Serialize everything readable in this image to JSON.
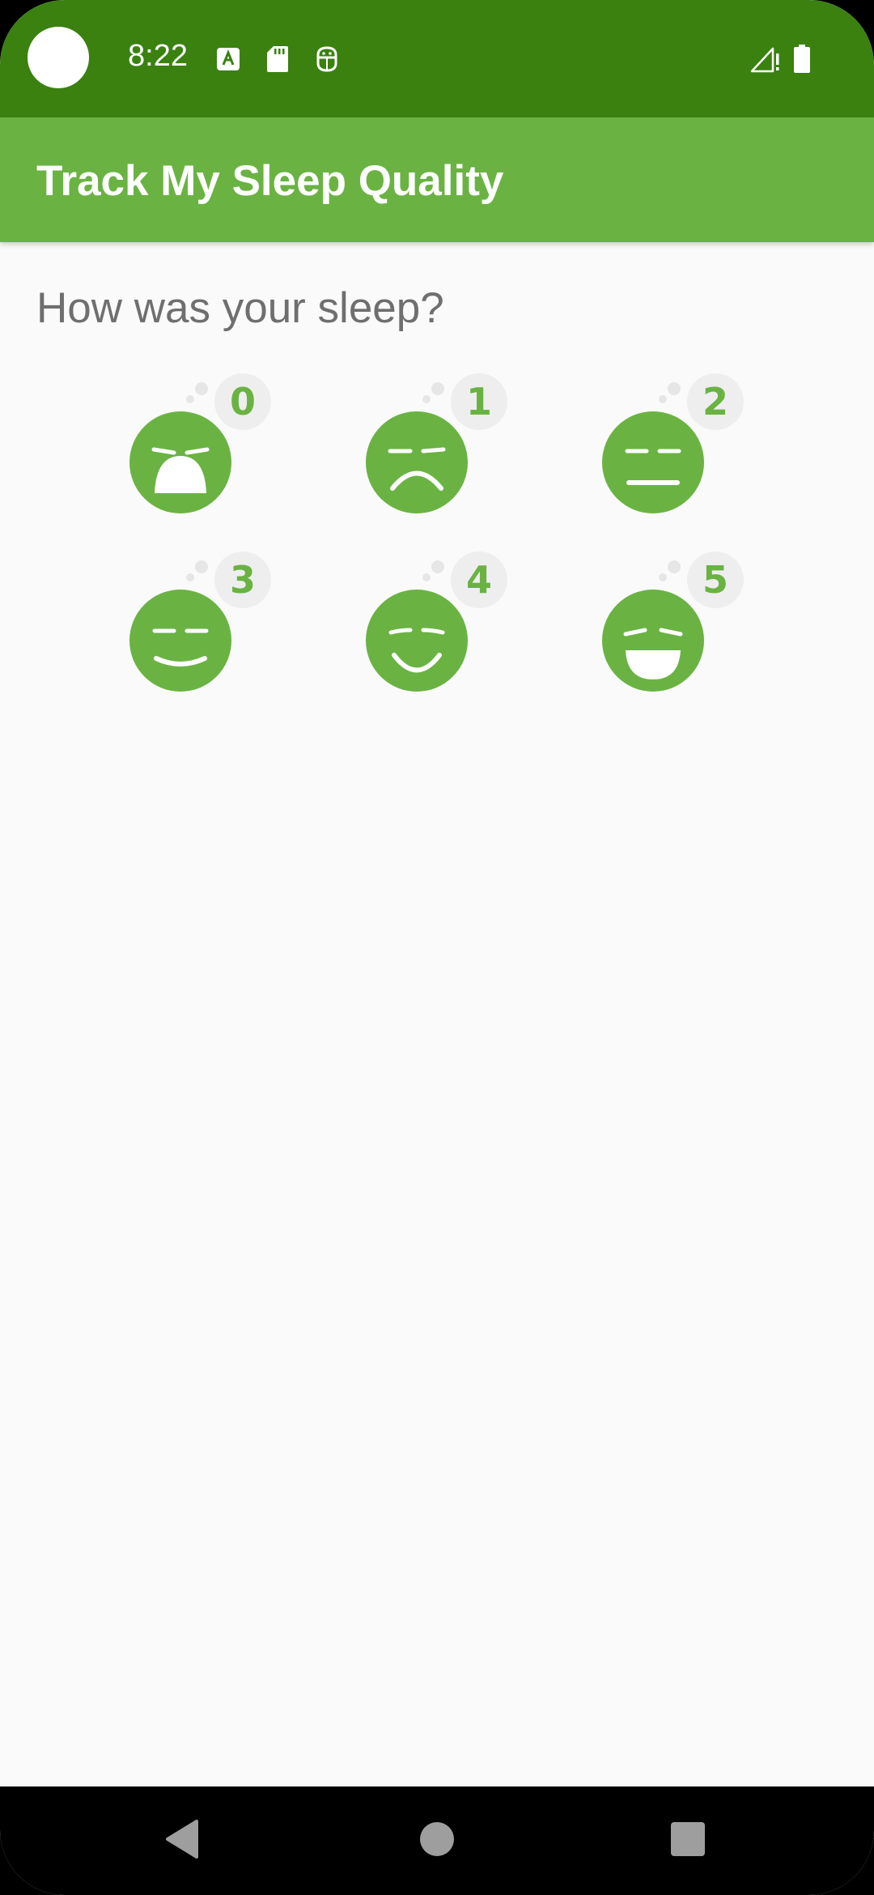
{
  "status_bar": {
    "time": "8:22",
    "notification_icons": [
      "font-notification-icon",
      "sd-card-icon",
      "android-debug-icon"
    ],
    "right_icons": [
      "signal-icon",
      "battery-icon"
    ]
  },
  "app_bar": {
    "title": "Track My Sleep Quality"
  },
  "main": {
    "question": "How was your sleep?",
    "quality_options": [
      {
        "rating": "0",
        "face": "very-sad-face-icon"
      },
      {
        "rating": "1",
        "face": "sad-face-icon"
      },
      {
        "rating": "2",
        "face": "neutral-face-icon"
      },
      {
        "rating": "3",
        "face": "slight-smile-face-icon"
      },
      {
        "rating": "4",
        "face": "smile-face-icon"
      },
      {
        "rating": "5",
        "face": "big-smile-face-icon"
      }
    ]
  },
  "nav_bar": {
    "buttons": [
      "back-icon",
      "home-icon",
      "recents-icon"
    ]
  },
  "colors": {
    "status_bar": "#3a8110",
    "app_bar": "#6ab343",
    "face": "#6ab343",
    "badge": "#eeeeee",
    "background": "#fafafa",
    "question_text": "#6f6f6f"
  }
}
